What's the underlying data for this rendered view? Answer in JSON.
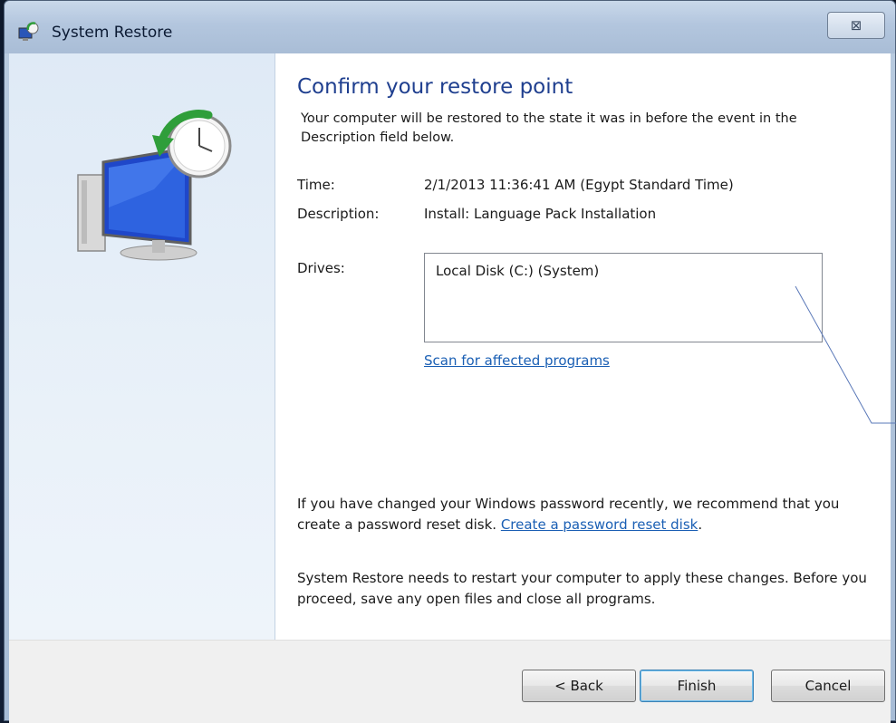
{
  "window": {
    "title": "System Restore"
  },
  "titlebar": {
    "close_glyph": "⊠"
  },
  "main": {
    "title": "Confirm your restore point",
    "intro": "Your computer will be restored to the state it was in before the event in the Description field below.",
    "time_label": "Time:",
    "time_value": "2/1/2013 11:36:41 AM (Egypt Standard Time)",
    "description_label": "Description:",
    "description_value": "Install: Language Pack Installation",
    "drives_label": "Drives:",
    "drives": [
      "Local Disk (C:) (System)"
    ],
    "scan_link": "Scan for affected programs",
    "password_text": "If you have changed your Windows password recently, we recommend that you create a password reset disk.",
    "password_link": "Create a password reset disk",
    "password_period": ".",
    "restart_text": "System Restore needs to restart your computer to apply these changes. Before you proceed, save any open files and close all programs."
  },
  "footer": {
    "back_label": "< Back",
    "finish_label": "Finish",
    "cancel_label": "Cancel"
  },
  "icons": {
    "title_icon": "system-restore-icon",
    "hero_icon": "monitor-clock-restore-icon"
  },
  "colors": {
    "title_blue": "#1f3f8f",
    "link_blue": "#1a5fb4"
  }
}
